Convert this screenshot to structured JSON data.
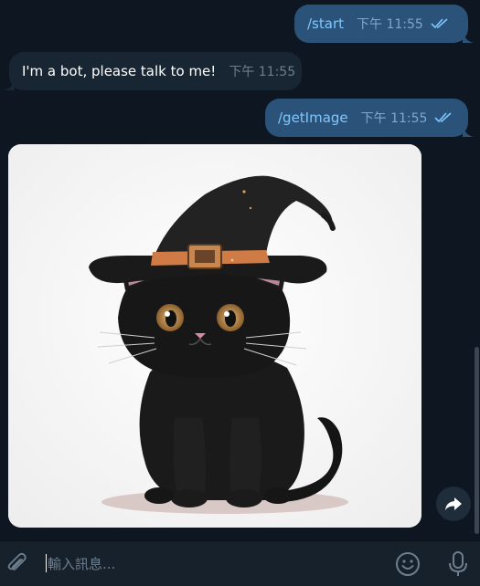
{
  "colors": {
    "background": "#0e1621",
    "outgoing_bubble": "#2b5278",
    "incoming_bubble": "#182533",
    "composer": "#17212b",
    "accent": "#7fc7ff"
  },
  "messages": [
    {
      "direction": "out",
      "text": "/start",
      "time": "下午 11:55",
      "status": "read"
    },
    {
      "direction": "in",
      "text": "I'm a bot, please talk to me!",
      "time": "下午 11:55"
    },
    {
      "direction": "out",
      "text": "/getImage",
      "time": "下午 11:55",
      "status": "read"
    },
    {
      "direction": "in",
      "type": "image",
      "image_icon": "black-cat-witch-hat-illustration"
    }
  ],
  "composer": {
    "placeholder": "輸入訊息...",
    "value": "",
    "attach_icon": "paperclip-icon",
    "emoji_icon": "smiley-icon",
    "voice_icon": "microphone-icon"
  },
  "forward_icon": "share-arrow-icon"
}
